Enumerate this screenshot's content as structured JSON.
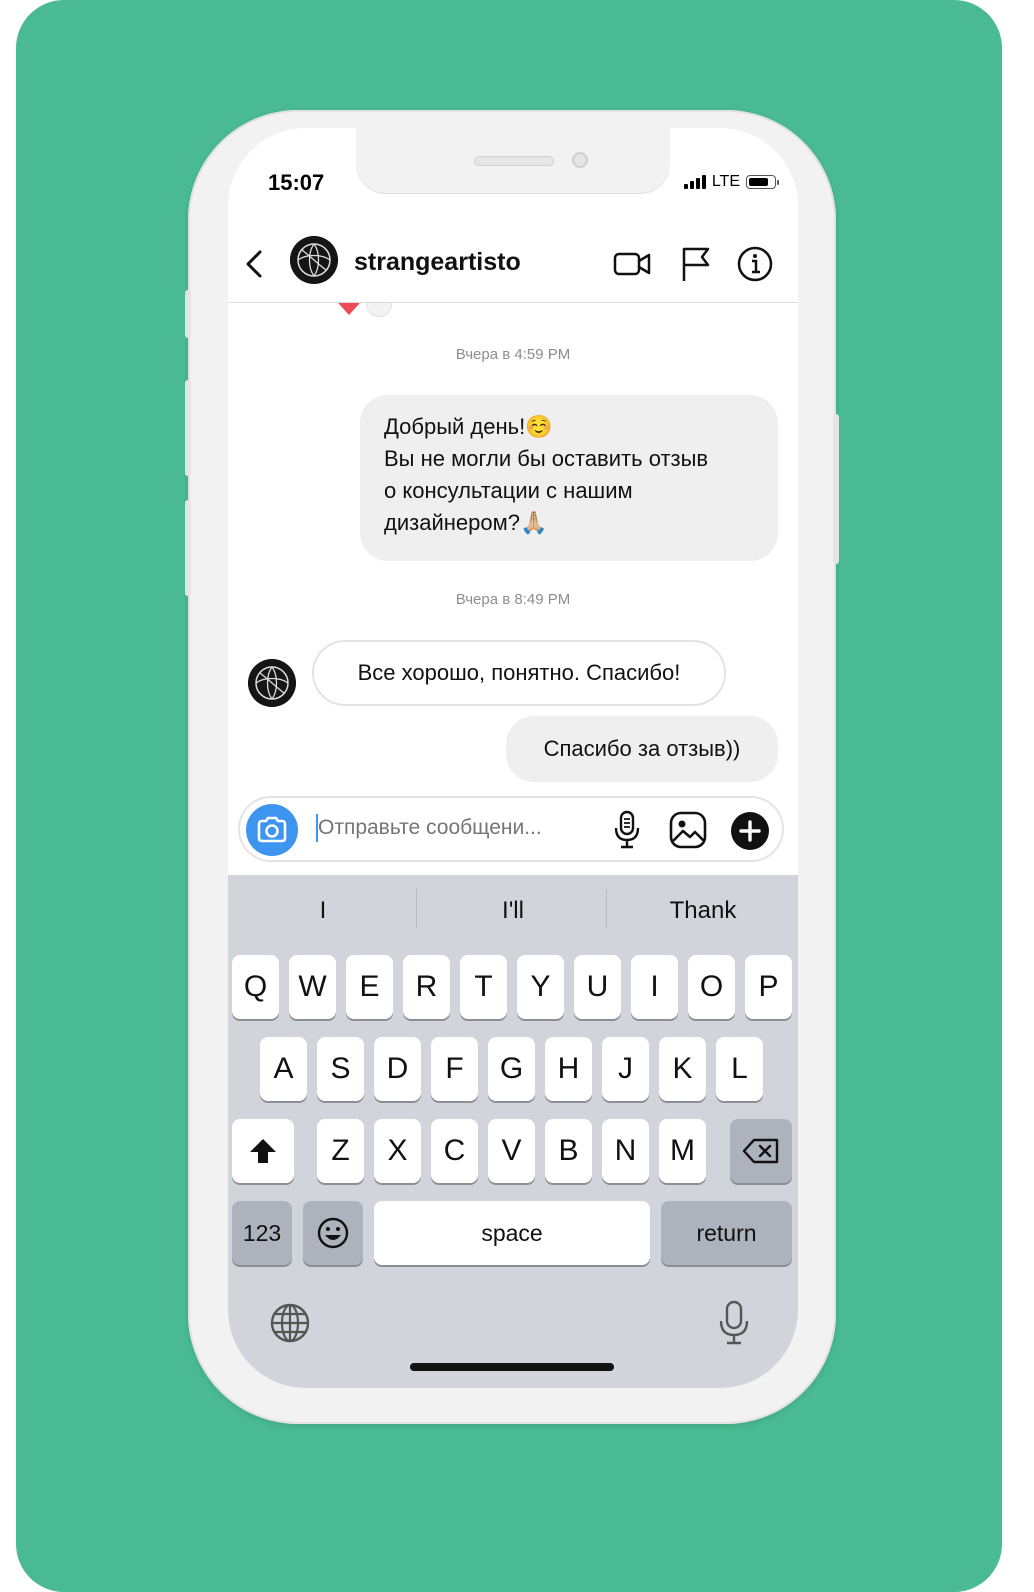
{
  "status_bar": {
    "time": "15:07",
    "network": "LTE"
  },
  "header": {
    "username": "strangeartisto"
  },
  "chat": {
    "messages": [
      {
        "timestamp": "Вчера в 4:59 PM"
      },
      {
        "direction": "outgoing",
        "lines": [
          "Добрый день!☺️",
          "Вы не могли бы оставить отзыв",
          "о консультации с нашим",
          "дизайнером?🙏🏼"
        ]
      },
      {
        "timestamp": "Вчера в 8:49 PM"
      },
      {
        "direction": "incoming",
        "text": "Все хорошо, понятно. Спасибо!"
      },
      {
        "direction": "outgoing",
        "text": "Спасибо за отзыв))"
      }
    ]
  },
  "composer": {
    "placeholder": "Отправьте сообщени..."
  },
  "keyboard": {
    "suggestions": [
      "I",
      "I'll",
      "Thank"
    ],
    "row1": [
      "Q",
      "W",
      "E",
      "R",
      "T",
      "Y",
      "U",
      "I",
      "O",
      "P"
    ],
    "row2": [
      "A",
      "S",
      "D",
      "F",
      "G",
      "H",
      "J",
      "K",
      "L"
    ],
    "row3": [
      "Z",
      "X",
      "C",
      "V",
      "B",
      "N",
      "M"
    ],
    "numbers_label": "123",
    "space_label": "space",
    "return_label": "return"
  },
  "colors": {
    "background": "#49BA93",
    "accent": "#3d95ef",
    "reaction": "#ed4956"
  }
}
